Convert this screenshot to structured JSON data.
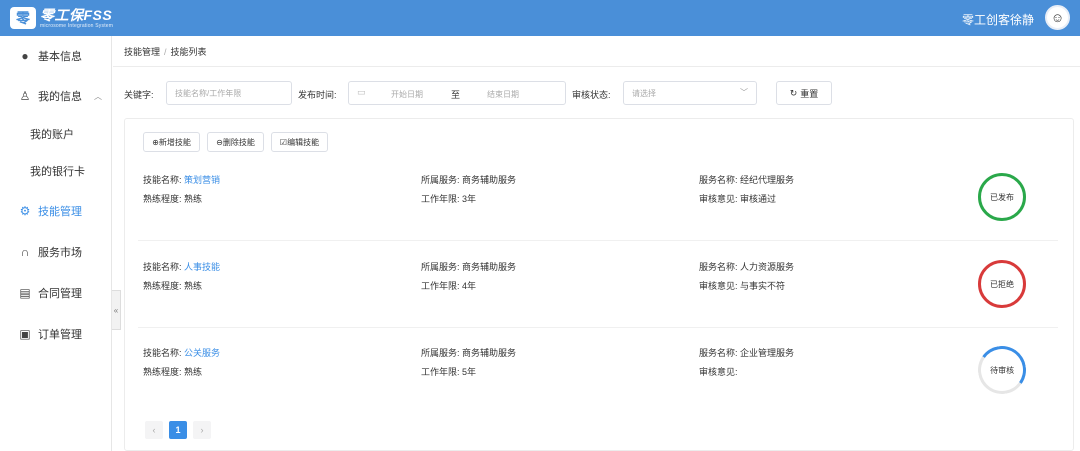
{
  "header": {
    "logo_mark": "零",
    "logo_title": "零工保FSS",
    "logo_sub": "microsome Integration System",
    "user_name": "零工创客徐静",
    "avatar_icon": "user-avatar-icon"
  },
  "sidebar": {
    "items": [
      {
        "label": "基本信息",
        "icon": "user-icon"
      },
      {
        "label": "我的信息",
        "icon": "person-outline-icon"
      },
      {
        "label": "我的账户"
      },
      {
        "label": "我的银行卡"
      },
      {
        "label": "技能管理",
        "icon": "gear-icon"
      },
      {
        "label": "服务市场",
        "icon": "headset-icon"
      },
      {
        "label": "合同管理",
        "icon": "document-icon"
      },
      {
        "label": "订单管理",
        "icon": "list-icon"
      }
    ],
    "collapse_label": "«"
  },
  "breadcrumb": {
    "root": "技能管理",
    "sep": "/",
    "current": "技能列表"
  },
  "filters": {
    "keyword_label": "关键字:",
    "keyword_placeholder": "技能名称/工作年限",
    "publish_time_label": "发布时间:",
    "start_placeholder": "开始日期",
    "to": "至",
    "end_placeholder": "结束日期",
    "audit_status_label": "审核状态:",
    "audit_status_placeholder": "请选择",
    "reset_label": "重置",
    "reset_icon": "↻"
  },
  "toolbar": {
    "add_label": "⊕新增技能",
    "delete_label": "⊖删除技能",
    "edit_label": "☑编辑技能"
  },
  "skills": [
    {
      "name_label": "技能名称:",
      "name": "策划营销",
      "service_label": "所属服务:",
      "service": "商务辅助服务",
      "service_name_label": "服务名称:",
      "service_name": "经纪代理服务",
      "proficiency_label": "熟练程度:",
      "proficiency": "熟练",
      "years_label": "工作年限:",
      "years": "3年",
      "opinion_label": "审核意见:",
      "opinion": "审核通过",
      "status": "已发布",
      "status_color": "#2aa84a"
    },
    {
      "name_label": "技能名称:",
      "name": "人事技能",
      "service_label": "所属服务:",
      "service": "商务辅助服务",
      "service_name_label": "服务名称:",
      "service_name": "人力资源服务",
      "proficiency_label": "熟练程度:",
      "proficiency": "熟练",
      "years_label": "工作年限:",
      "years": "4年",
      "opinion_label": "审核意见:",
      "opinion": "与事实不符",
      "status": "已拒绝",
      "status_color": "#d83a3a"
    },
    {
      "name_label": "技能名称:",
      "name": "公关服务",
      "service_label": "所属服务:",
      "service": "商务辅助服务",
      "service_name_label": "服务名称:",
      "service_name": "企业管理服务",
      "proficiency_label": "熟练程度:",
      "proficiency": "熟练",
      "years_label": "工作年限:",
      "years": "5年",
      "opinion_label": "审核意见:",
      "opinion": "",
      "status": "待审核",
      "status_color": "#3a8ee6"
    }
  ],
  "pagination": {
    "prev": "‹",
    "current_page": "1",
    "next": "›"
  },
  "colors": {
    "accent": "#3a8ee6",
    "header_bg": "#4a8fd8"
  }
}
